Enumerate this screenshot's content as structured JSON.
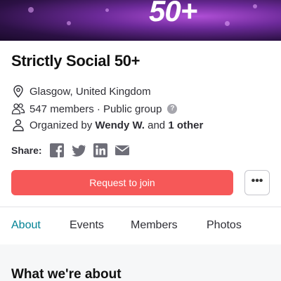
{
  "banner": {
    "text": "50+"
  },
  "group": {
    "title": "Strictly Social 50+",
    "location": "Glasgow, United Kingdom",
    "members_text": "547 members · Public group",
    "organized_prefix": "Organized by",
    "organizer_name": "Wendy W.",
    "organized_and": "and",
    "organizer_others": "1 other"
  },
  "share": {
    "label": "Share:",
    "icons": [
      "facebook-icon",
      "twitter-icon",
      "linkedin-icon",
      "email-icon"
    ]
  },
  "actions": {
    "join_label": "Request to join",
    "more_label": "•••"
  },
  "tabs": [
    {
      "label": "About",
      "active": true
    },
    {
      "label": "Events",
      "active": false
    },
    {
      "label": "Members",
      "active": false
    },
    {
      "label": "Photos",
      "active": false
    }
  ],
  "about": {
    "heading": "What we're about"
  },
  "colors": {
    "accent": "#008294",
    "join_button": "#f65858",
    "banner": "#6c2a99"
  }
}
